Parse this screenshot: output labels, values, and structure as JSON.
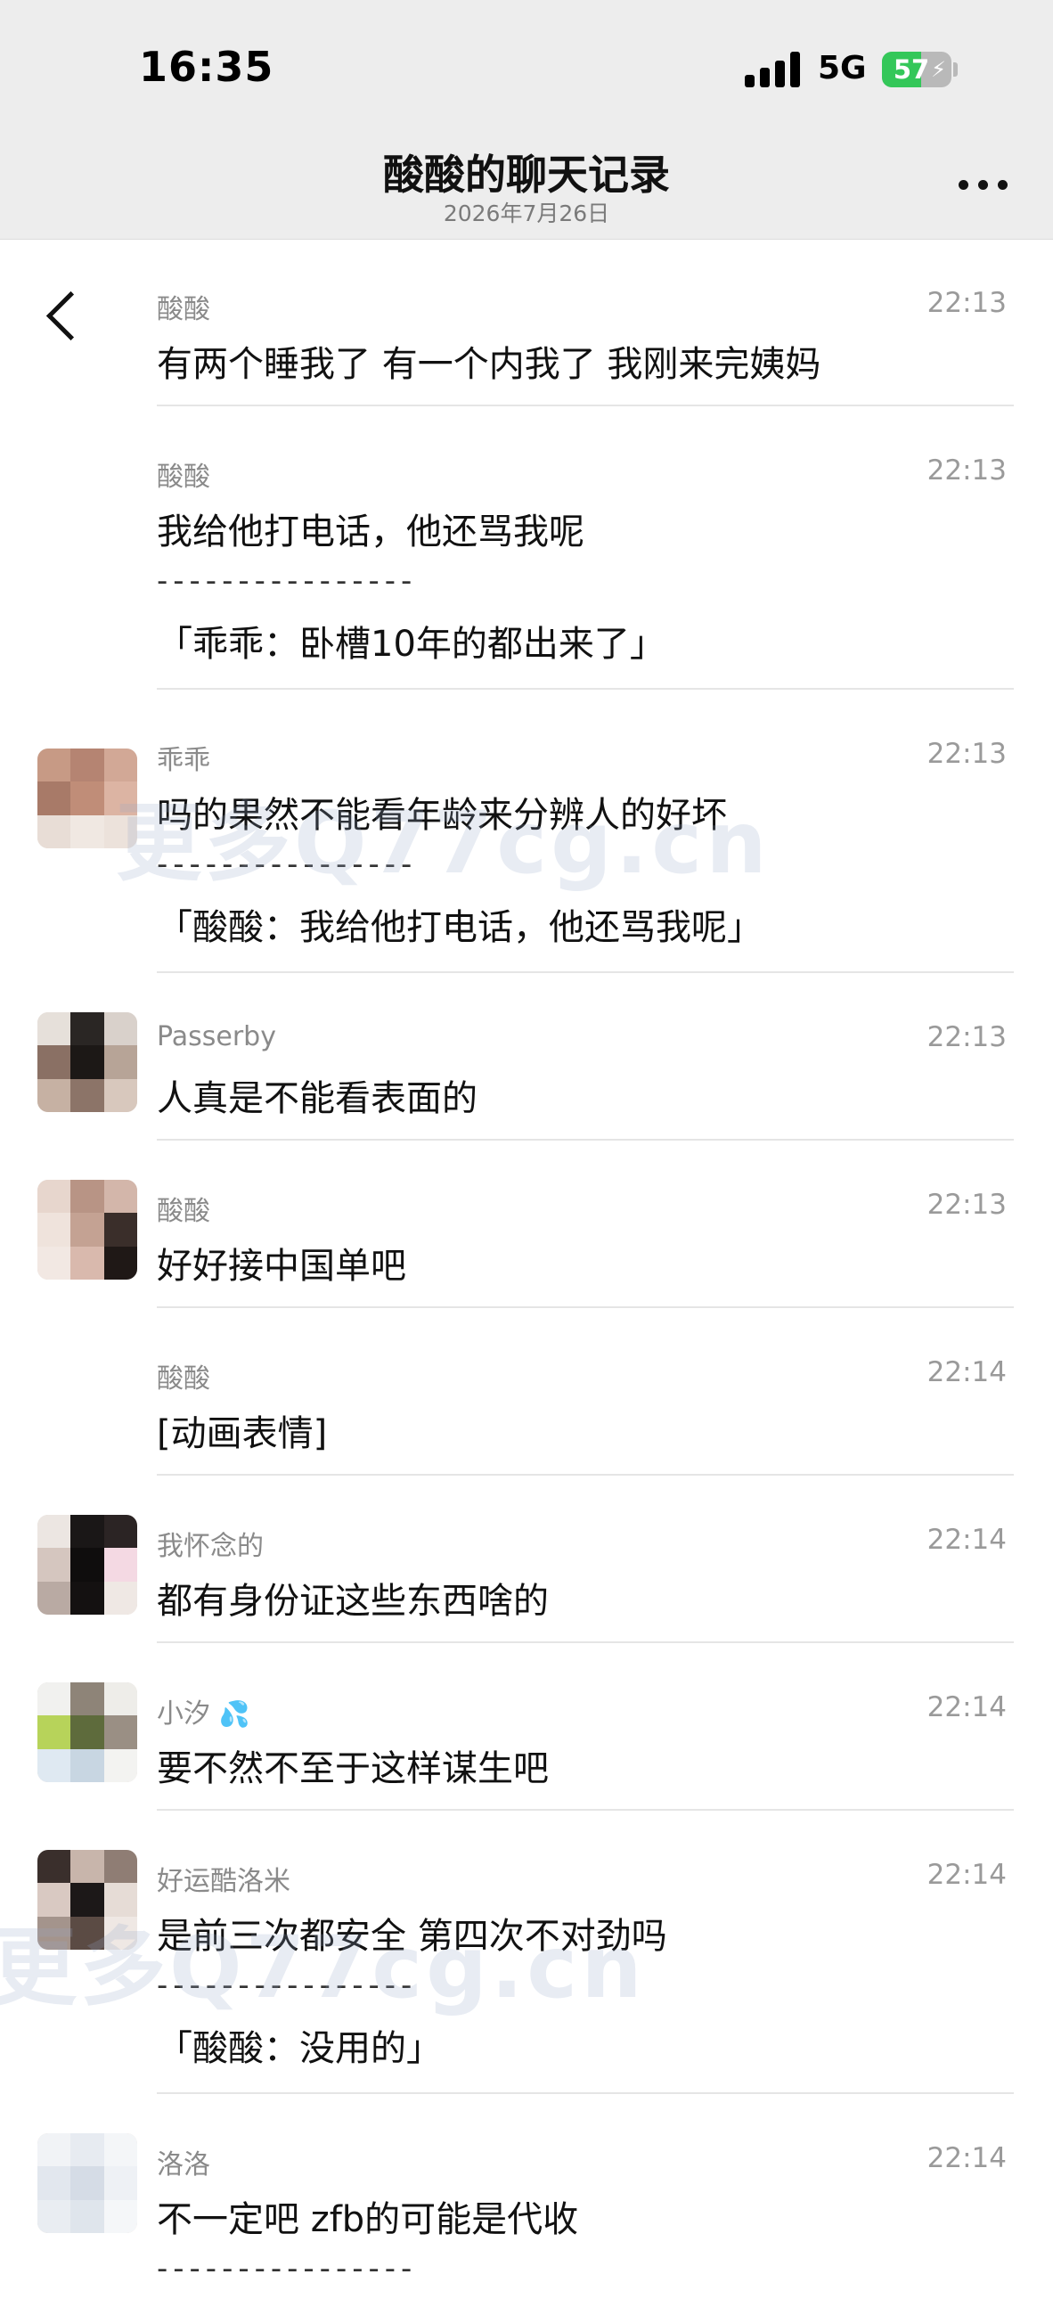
{
  "status_bar": {
    "time": "16:35",
    "network": "5G",
    "battery": "57",
    "battery_level": 0.57,
    "bolt": "⚡"
  },
  "nav": {
    "title": "酸酸的聊天记录",
    "date": "2026年7月26日"
  },
  "messages": [
    {
      "sender": "酸酸",
      "time": "22:13",
      "text": "有两个睡我了 有一个内我了 我刚来完姨妈"
    },
    {
      "sender": "酸酸",
      "time": "22:13",
      "text": "我给他打电话，他还骂我呢",
      "divider": "----------------",
      "quote": "「乖乖：卧槽10年的都出来了」"
    },
    {
      "sender": "乖乖",
      "time": "22:13",
      "text": "吗的果然不能看年龄来分辨人的好坏",
      "divider": "----------------",
      "quote": "「酸酸：我给他打电话，他还骂我呢」"
    },
    {
      "sender": "Passerby",
      "time": "22:13",
      "text": "人真是不能看表面的"
    },
    {
      "sender": "酸酸",
      "time": "22:13",
      "text": "好好接中国单吧"
    },
    {
      "sender": "酸酸",
      "time": "22:14",
      "text": "[动画表情]"
    },
    {
      "sender": "我怀念的",
      "time": "22:14",
      "text": "都有身份证这些东西啥的"
    },
    {
      "sender": "小汐",
      "sender_emoji": "💦",
      "time": "22:14",
      "text": "要不然不至于这样谋生吧"
    },
    {
      "sender": "好运酷洛米",
      "time": "22:14",
      "text": "是前三次都安全 第四次不对劲吗",
      "divider": "----------------",
      "quote": "「酸酸：没用的」"
    },
    {
      "sender": "洛洛",
      "time": "22:14",
      "text": "不一定吧 zfb的可能是代收",
      "divider": "----------------"
    }
  ],
  "watermark": {
    "text1": "更多Q77cg.cn",
    "text2": "更多Q77cg.cn"
  },
  "colors": {
    "header_bg": "#ededed",
    "battery": "#34c759",
    "meta": "#8a8a8a"
  }
}
